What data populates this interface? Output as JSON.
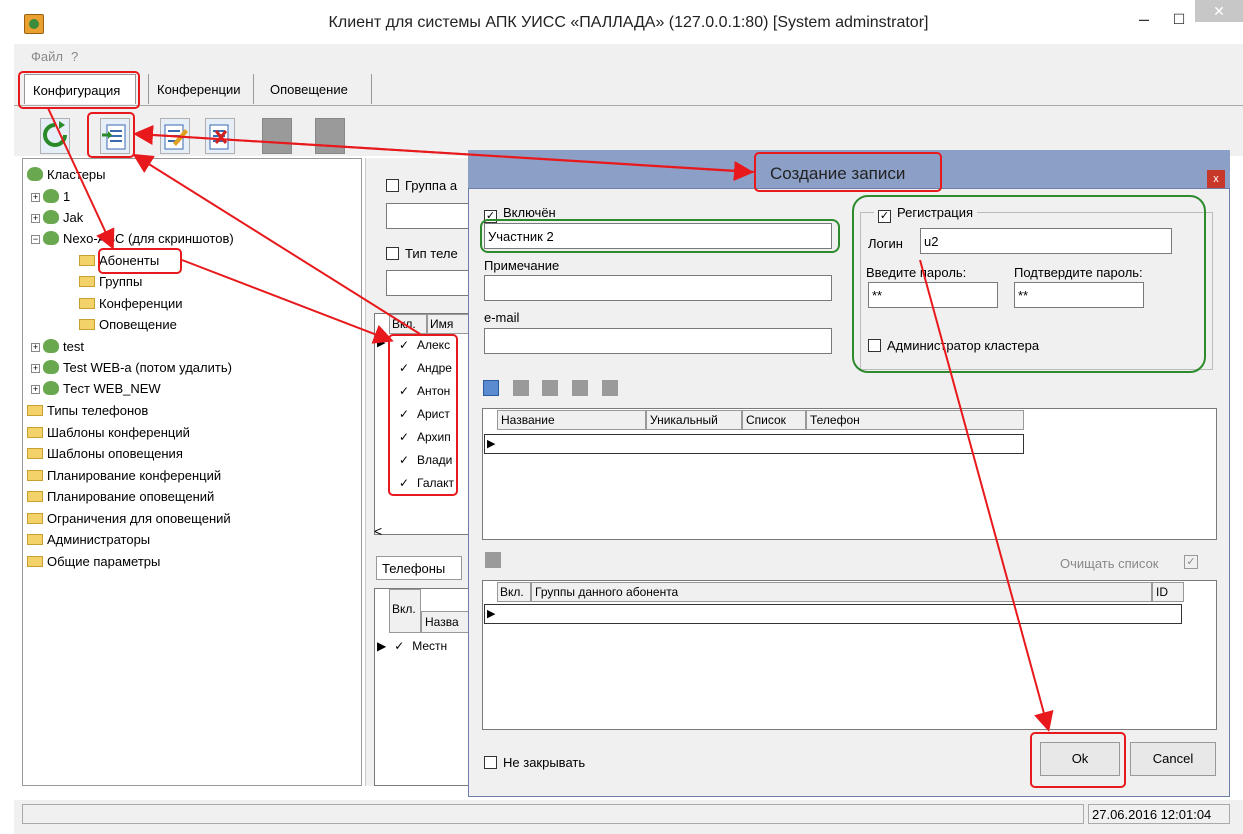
{
  "window": {
    "title": "Клиент для системы АПК УИСС «ПАЛЛАДА» (127.0.0.1:80) [System adminstrator]"
  },
  "menu": {
    "file": "Файл",
    "help": "?"
  },
  "tabs": [
    "Конфигурация",
    "Конференции",
    "Оповещение"
  ],
  "tree": {
    "root": "Кластеры",
    "clusters": [
      "1",
      "Jak",
      "Nexo-ASC (для скриншотов)"
    ],
    "sub": [
      "Абоненты",
      "Группы",
      "Конференции",
      "Оповещение"
    ],
    "more_clusters": [
      "test",
      "Test WEB-a (потом удалить)",
      "Тест WEB_NEW"
    ],
    "folders": [
      "Типы телефонов",
      "Шаблоны конференций",
      "Шаблоны оповещения",
      "Планирование конференций",
      "Планирование оповещений",
      "Ограничения для оповещений",
      "Администраторы",
      "Общие параметры"
    ]
  },
  "mid": {
    "group_filter": "Группа а",
    "phone_type_filter": "Тип теле",
    "col_enabled": "Вкл.",
    "col_name": "Имя",
    "rows": [
      "Алекс",
      "Андре",
      "Антон",
      "Арист",
      "Архип",
      "Влади",
      "Галакт"
    ],
    "phones_tab": "Телефоны",
    "lower_col_enabled": "Вкл.",
    "lower_col_name": "Назва",
    "lower_row": "Местн",
    "scroll_left": "<"
  },
  "dialog": {
    "title": "Создание записи",
    "close": "x",
    "enabled_label": "Включён",
    "name_value": "Участник 2",
    "note_label": "Примечание",
    "note_value": "",
    "email_label": "e-mail",
    "email_value": "",
    "registration_label": "Регистрация",
    "login_label": "Логин",
    "login_value": "u2",
    "password_label": "Введите пароль:",
    "password_value": "**",
    "confirm_label": "Подтвердите пароль:",
    "confirm_value": "**",
    "cluster_admin_label": "Администратор кластера",
    "phones_cols": [
      "Название",
      "Уникальный",
      "Список",
      "Телефон"
    ],
    "clear_list_label": "Очищать список",
    "groups_col_enabled": "Вкл.",
    "groups_col_name": "Группы данного абонента",
    "groups_col_id": "ID",
    "dont_close_label": "Не закрывать",
    "ok_label": "Ok",
    "cancel_label": "Cancel"
  },
  "status": {
    "datetime": "27.06.2016 12:01:04"
  },
  "colors": {
    "annotation_red": "#e8191c",
    "annotation_green": "#2d8a2d",
    "dialog_frame": "#8c9fc6"
  }
}
